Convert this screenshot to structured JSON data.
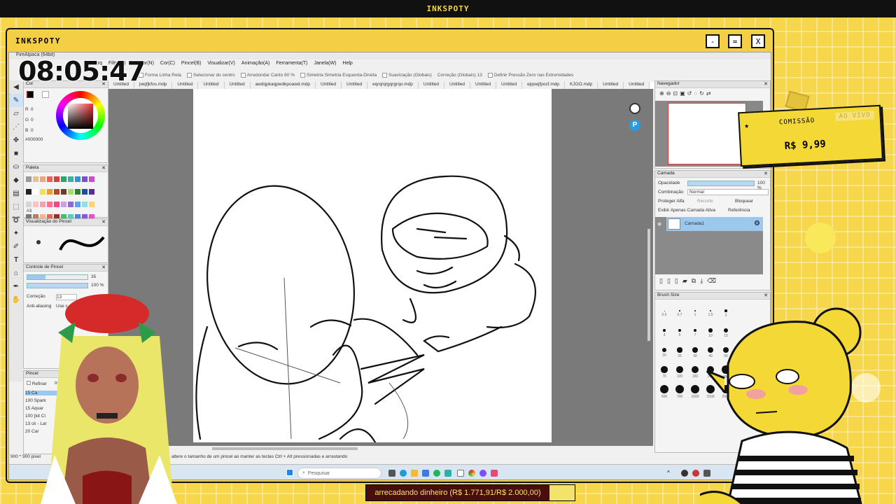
{
  "overlay": {
    "topbar_title": "INKSPOTY",
    "window_title": "INKSPOTY",
    "window_buttons": [
      "-",
      "=",
      "X"
    ],
    "clock": "08:05:47",
    "commission": {
      "label": "COMISSÃO",
      "live": "AO VIVO",
      "price": "R$ 9,99"
    },
    "donation": "arrecadando dinheiro (R$ 1.771,91/R$ 2.000,00)"
  },
  "app": {
    "title": "FireAlpaca (64bit)",
    "menu": [
      "Arq",
      "Filtro(F)",
      "Ajustar(N)",
      "Cor(C)",
      "Pincel(B)",
      "Visualizar(V)",
      "Animação(A)",
      "Ferramenta(T)",
      "Janela(W)",
      "Help"
    ],
    "tool_options": {
      "forma": "Forma",
      "forma_value": "Linha Reta",
      "selecionar": "Selecionar do centro",
      "arredondar": "Arredondar Canto",
      "arredondar_value": "80",
      "percent": "%",
      "simetria": "Simetria",
      "simetria_value": "Simetria Esquerda-Direita",
      "suavizacao": "Suavização (Globais)",
      "correcao": "Correção (Globais)",
      "correcao_value": "13",
      "pressao": "Definir Pressão Zero nas Extremidades"
    },
    "tabs": [
      "Untitled",
      "jwqfjkfos.mdp",
      "Untitled",
      "Untitled",
      "Untitled",
      "awdqpkaqpwdkpoawd.mdp",
      "Untitled",
      "Untitled",
      "eqrqrqrgqrgrqo.mdp",
      "Untitled",
      "Untitled",
      "Untitled",
      "Untitled",
      "ejqoejfpocf.mdp",
      "KJOO.mdp",
      "Untitled",
      "Untitled",
      "Untitled"
    ],
    "status": "900 * 900 pixel",
    "hint": "Faça uma linha reta ao manter a tecla Shift pressionada, altere o tamanho de um pincel ao manter as teclas Ctrl + Alt pressionadas e arrastando",
    "search_placeholder": "Pesquisar"
  },
  "panels": {
    "cor": {
      "title": "Cor",
      "r_label": "R",
      "g_label": "G",
      "b_label": "B",
      "r": "0",
      "g": "0",
      "b": "0",
      "hex": "#000000"
    },
    "paleta": {
      "title": "Paleta",
      "num": "#3"
    },
    "visualizacao": {
      "title": "Visualização do Pincel"
    },
    "controle": {
      "title": "Controle de Pincel",
      "size": "35",
      "opacity": "100 %",
      "correcao_label": "Correção",
      "correcao": "13",
      "antialias": "Anti-aliasing",
      "use": "Use c"
    },
    "pincel": {
      "title": "Pincel",
      "refinar": "Refinar",
      "inverter": "Inver",
      "items": [
        {
          "size": "15",
          "name": "Ca"
        },
        {
          "size": "100",
          "name": "Spark"
        },
        {
          "size": "15",
          "name": "Aquar"
        },
        {
          "size": "100",
          "name": "[kit Cl"
        },
        {
          "size": "13",
          "name": "ck - Lar"
        },
        {
          "size": "20",
          "name": "Car"
        }
      ]
    },
    "navegador": {
      "title": "Navegador"
    },
    "camada": {
      "title": "Camada",
      "opacidade": "Opacidade",
      "opacidade_value": "100 %",
      "combinacao": "Combinação",
      "combinacao_value": "Normal",
      "proteger": "Proteger Alfa",
      "recorte": "Recorte",
      "bloquear": "Bloquear",
      "exibir": "Exibir Apenas Camada Ativa",
      "referencia": "Referência",
      "layer_name": "Camada1"
    },
    "brush_size": {
      "title": "Brush Size",
      "labels": [
        "0.5",
        "0.7",
        "1",
        "1.5",
        "2",
        "3",
        "5",
        "7",
        "10",
        "15",
        "20",
        "25",
        "30",
        "40",
        "50",
        "70",
        "100",
        "150",
        "200",
        "300",
        "500",
        "700",
        "1000",
        "1500",
        "2000"
      ]
    }
  },
  "palette_colors": [
    "#9b9b9b",
    "#e8c08a",
    "#f3a37a",
    "#e86060",
    "#d73e3e",
    "#2aa46a",
    "#36b3a8",
    "#3c8fd6",
    "#7a4fd1",
    "#c84fc8",
    "#222222",
    "#ffffff",
    "#f6e04a",
    "#f39b2e",
    "#b44a2a",
    "#6b3d2a",
    "#9ee06b",
    "#2e7d32",
    "#1a4fa0",
    "#5b2d8e",
    "#d6d6d6",
    "#f7c4c4",
    "#f4a0b8",
    "#ff6f91",
    "#ee4a8a",
    "#c9a3e0",
    "#8c6bd6",
    "#5fa3f0",
    "#8ce0e6",
    "#ffd27a",
    "#777777",
    "#b08060",
    "#ffb38a",
    "#e0675b",
    "#a02c2c",
    "#41c06b",
    "#50d0c0",
    "#5080e0",
    "#9050e0",
    "#e050d0"
  ]
}
